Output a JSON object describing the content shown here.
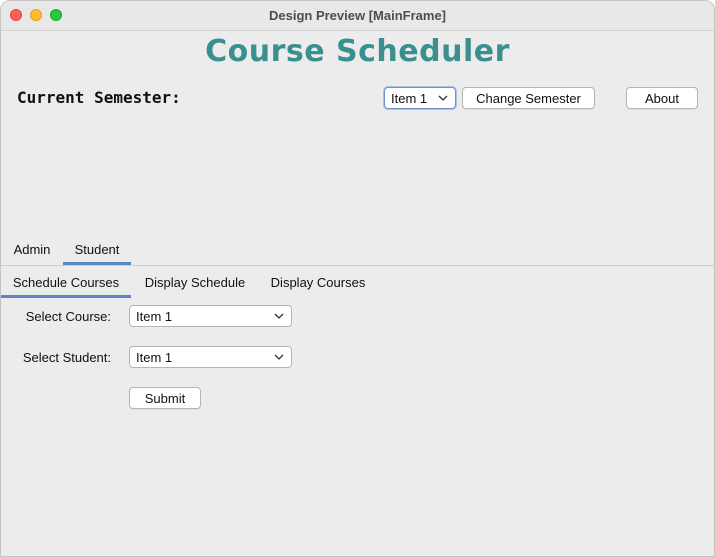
{
  "window": {
    "title": "Design Preview [MainFrame]"
  },
  "app": {
    "title": "Course Scheduler"
  },
  "semester": {
    "label": "Current Semester:",
    "combo_value": "Item 1",
    "change_button": "Change Semester",
    "about_button": "About"
  },
  "outer_tabs": [
    {
      "label": "Admin",
      "selected": false
    },
    {
      "label": "Student",
      "selected": true
    }
  ],
  "inner_tabs": [
    {
      "label": "Schedule Courses",
      "selected": true
    },
    {
      "label": "Display Schedule",
      "selected": false
    },
    {
      "label": "Display Courses",
      "selected": false
    }
  ],
  "form": {
    "course_label": "Select Course:",
    "course_value": "Item 1",
    "student_label": "Select Student:",
    "student_value": "Item 1",
    "submit_button": "Submit"
  },
  "colors": {
    "accent": "#5b86c5",
    "title": "#3a8f8f"
  },
  "icons": {
    "combo_arrow": "chevron-down-icon"
  }
}
